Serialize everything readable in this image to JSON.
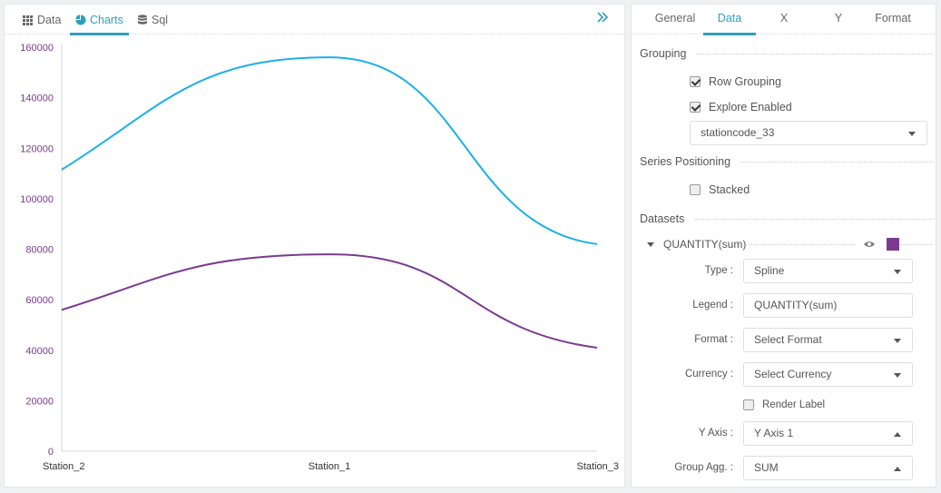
{
  "left_tabs": [
    {
      "label": "Data",
      "icon": "grid-icon"
    },
    {
      "label": "Charts",
      "icon": "pie-chart-icon"
    },
    {
      "label": "Sql",
      "icon": "database-icon"
    }
  ],
  "colors": {
    "accent": "#2f9fbb",
    "series1": "#1ab0ea",
    "series2": "#7b3a8f",
    "axis_text": "#7b3a8f"
  },
  "chart_data": {
    "type": "line",
    "categories": [
      "Station_2",
      "Station_1",
      "Station_3"
    ],
    "series": [
      {
        "values": [
          111500,
          156000,
          82000
        ],
        "color": "#1ab0ea"
      },
      {
        "values": [
          56000,
          78000,
          41000
        ],
        "color": "#7b3a8f"
      }
    ],
    "yticks": [
      "0",
      "20000",
      "40000",
      "60000",
      "80000",
      "100000",
      "120000",
      "140000",
      "160000"
    ],
    "ylim": [
      0,
      160000
    ],
    "grid": false,
    "smooth": true
  },
  "right_tabs": [
    "General",
    "Data",
    "X",
    "Y",
    "Format"
  ],
  "right_active_tab": "Data",
  "grouping": {
    "title": "Grouping",
    "row_grouping": {
      "label": "Row Grouping",
      "checked": true
    },
    "explore_enabled": {
      "label": "Explore Enabled",
      "checked": true
    },
    "field": "stationcode_33"
  },
  "series_positioning": {
    "title": "Series Positioning",
    "stacked": {
      "label": "Stacked",
      "checked": false
    }
  },
  "datasets": {
    "title": "Datasets",
    "name": "QUANTITY(sum)",
    "swatch_color": "#7b3a8f",
    "type_label": "Type :",
    "type_value": "Spline",
    "legend_label": "Legend :",
    "legend_value": "QUANTITY(sum)",
    "format_label": "Format :",
    "format_value": "Select Format",
    "currency_label": "Currency :",
    "currency_value": "Select Currency",
    "render_label": {
      "label": "Render Label",
      "checked": false
    },
    "yaxis_label": "Y Axis :",
    "yaxis_value": "Y Axis 1",
    "group_agg_label": "Group Agg. :",
    "group_agg_value": "SUM"
  }
}
